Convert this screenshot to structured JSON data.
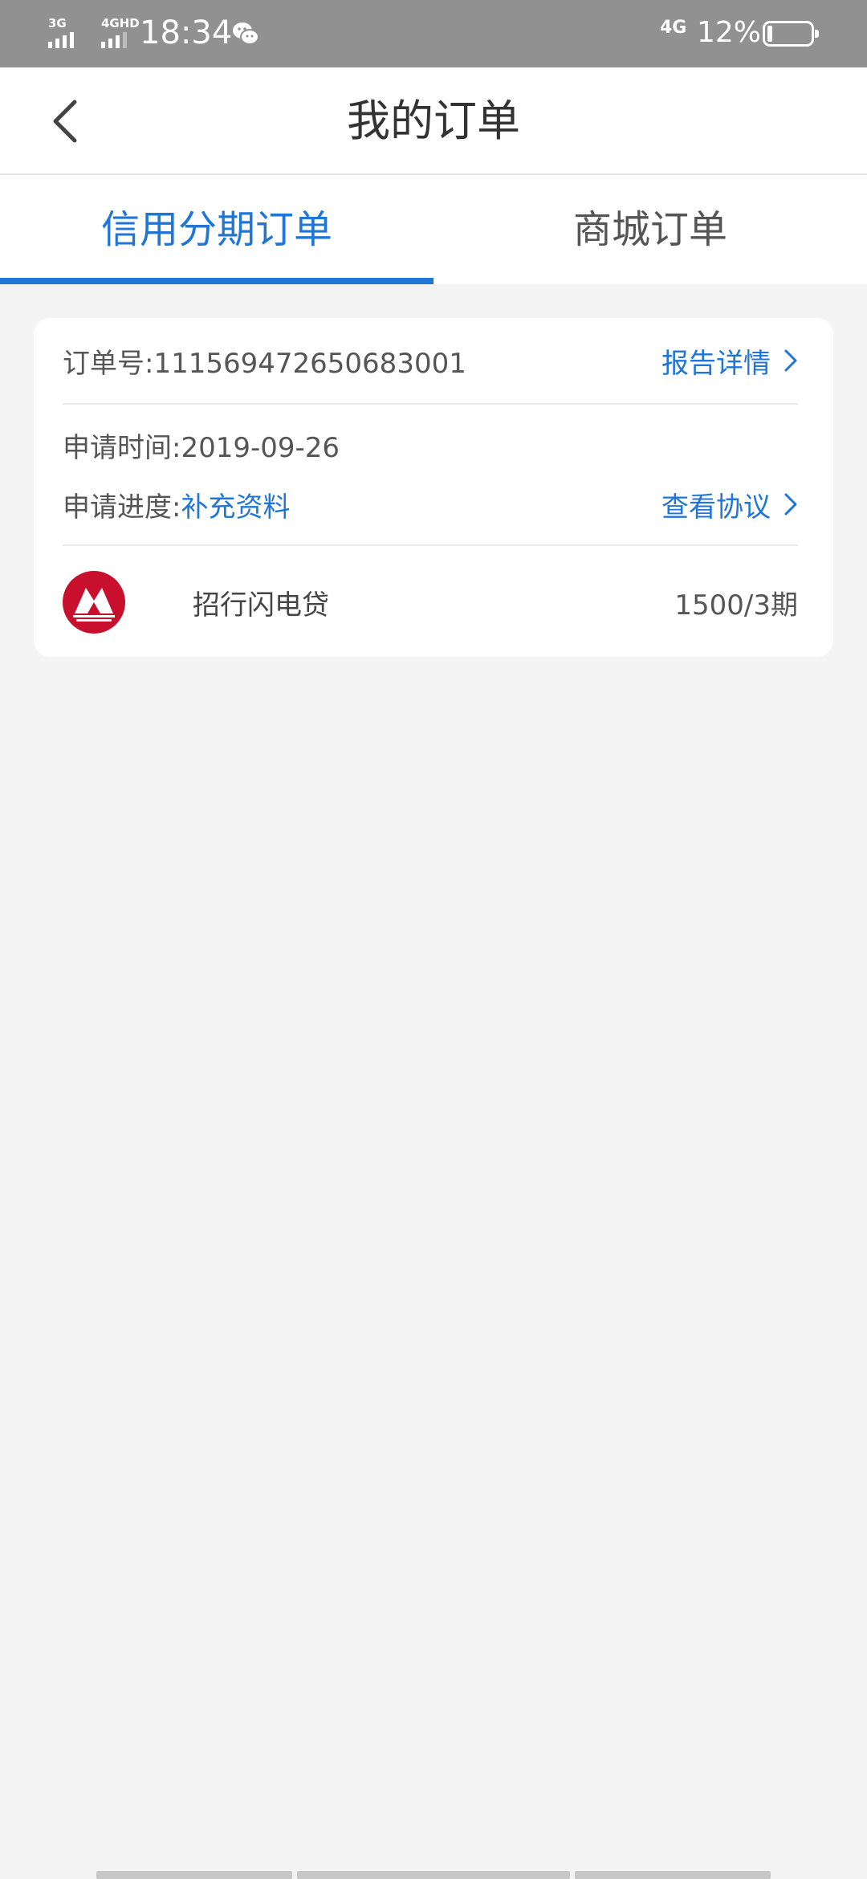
{
  "status_bar": {
    "signal1": "3G",
    "signal2": "4GHD",
    "time": "18:34",
    "net": "4G",
    "battery": "12%",
    "battery_level": 0.12
  },
  "header": {
    "title": "我的订单"
  },
  "tabs": [
    {
      "label": "信用分期订单",
      "active": true
    },
    {
      "label": "商城订单",
      "active": false
    }
  ],
  "order": {
    "order_no_label": "订单号:",
    "order_no": "111569472650683001",
    "report_link": "报告详情",
    "apply_time_label": "申请时间:",
    "apply_time": "2019-09-26",
    "progress_label": "申请进度:",
    "progress_value": "补充资料",
    "agreement_link": "查看协议",
    "product_name": "招行闪电贷",
    "product_amount": "1500/3期"
  },
  "colors": {
    "accent": "#1f76d6",
    "logo": "#c8102e"
  }
}
